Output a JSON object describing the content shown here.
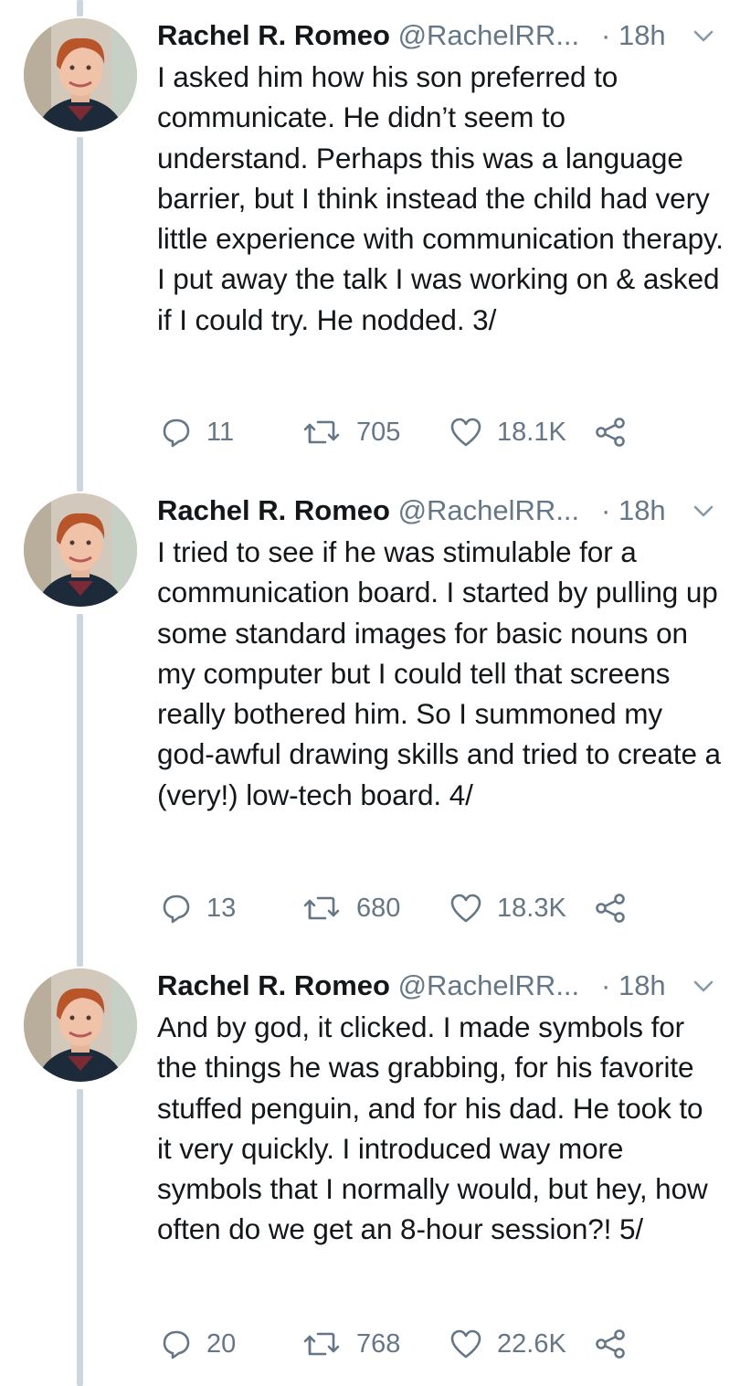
{
  "tweets": [
    {
      "author_name": "Rachel R. Romeo",
      "handle": "@RachelRR...",
      "separator": "·",
      "time": "18h",
      "text": "I asked him how his son preferred to communicate. He didn’t seem to understand. Perhaps this was a language barrier, but I think instead the child had very little experience with communication therapy. I put away the talk I was working on & asked if I could try. He nodded. 3/",
      "replies": "11",
      "retweets": "705",
      "likes": "18.1K"
    },
    {
      "author_name": "Rachel R. Romeo",
      "handle": "@RachelRR...",
      "separator": "·",
      "time": "18h",
      "text": "I tried to see if he was stimulable for a communication board. I started by pulling up some standard images for basic nouns on my computer but I could tell that screens really bothered him. So I summoned my god-awful drawing skills and tried to create a (very!) low-tech board. 4/",
      "replies": "13",
      "retweets": "680",
      "likes": "18.3K"
    },
    {
      "author_name": "Rachel R. Romeo",
      "handle": "@RachelRR...",
      "separator": "·",
      "time": "18h",
      "text": "And by god, it clicked. I made symbols for the things he was grabbing, for his favorite stuffed penguin, and for his dad. He took to it very quickly. I introduced way more symbols that I normally would, but hey, how often do we get an 8-hour session?! 5/",
      "replies": "20",
      "retweets": "768",
      "likes": "22.6K"
    }
  ],
  "icons": {
    "reply": "reply-icon",
    "retweet": "retweet-icon",
    "like": "heart-icon",
    "share": "share-icon",
    "menu": "chevron-down-icon"
  },
  "colors": {
    "text": "#14171a",
    "secondary": "#657786",
    "thread_line": "#ccd6dd"
  }
}
